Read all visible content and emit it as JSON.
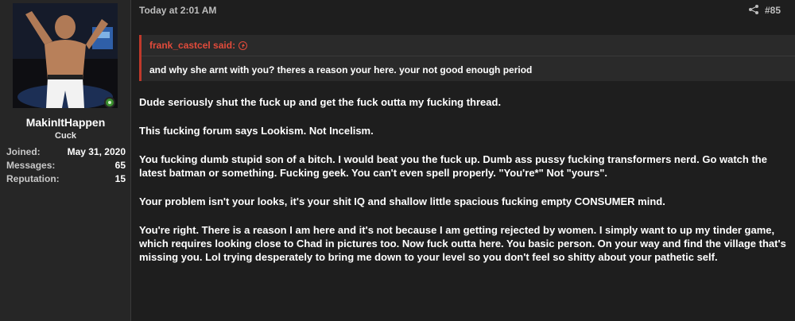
{
  "user": {
    "name": "MakinItHappen",
    "title": "Cuck",
    "stats": [
      {
        "label": "Joined:",
        "value": "May 31, 2020"
      },
      {
        "label": "Messages:",
        "value": "65"
      },
      {
        "label": "Reputation:",
        "value": "15"
      }
    ]
  },
  "post": {
    "timestamp": "Today at 2:01 AM",
    "number": "#85",
    "quote": {
      "author_line": "frank_castcel said:",
      "text": "and why she arnt with you? theres a reason your here. your not good enough period"
    },
    "paragraphs": [
      "Dude seriously shut the fuck up and get the fuck outta my fucking thread.",
      "This fucking forum says Lookism. Not Incelism.",
      "You fucking dumb stupid son of a bitch. I would beat you the fuck up. Dumb ass pussy fucking transformers nerd. Go watch the latest batman or something. Fucking geek. You can't even spell properly. \"You're*\" Not \"yours\".",
      "Your problem isn't your looks, it's your shit IQ and shallow little spacious fucking empty CONSUMER mind.",
      "You're right. There is a reason I am here and it's not because I am getting rejected by women. I simply want to up my tinder game, which requires looking close to Chad in pictures too. Now fuck outta here. You basic person. On your way and find the village that's missing you. Lol trying desperately to bring me down to your level so you don't feel so shitty about your pathetic self."
    ]
  },
  "icons": {
    "share": "share-icon",
    "quote_jump": "arrow-up-circle-icon",
    "online": "online-status-icon"
  },
  "colors": {
    "accent": "#e24b3b",
    "background": "#1e1e1e",
    "sidebar": "#262626",
    "online": "#3a8f2e"
  }
}
